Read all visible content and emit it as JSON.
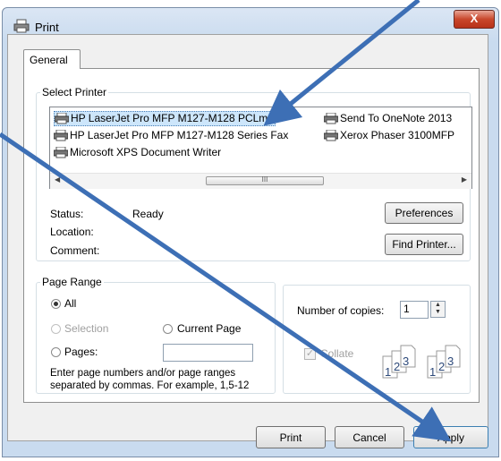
{
  "window": {
    "title": "Print",
    "close_label": "X"
  },
  "tabs": [
    {
      "label": "General"
    }
  ],
  "select_printer": {
    "legend": "Select Printer",
    "printers": [
      {
        "name": "HP LaserJet Pro MFP M127-M128 PCLmS",
        "selected": true
      },
      {
        "name": "Send To OneNote 2013",
        "selected": false
      },
      {
        "name": "HP LaserJet Pro MFP M127-M128 Series Fax",
        "selected": false
      },
      {
        "name": "Xerox Phaser 3100MFP",
        "selected": false
      },
      {
        "name": "Microsoft XPS Document Writer",
        "selected": false
      }
    ],
    "scroll_thumb_label": "III",
    "status_label": "Status:",
    "status_value": "Ready",
    "location_label": "Location:",
    "comment_label": "Comment:",
    "preferences_button": "Preferences",
    "find_printer_button": "Find Printer..."
  },
  "page_range": {
    "legend": "Page Range",
    "all_label": "All",
    "selection_label": "Selection",
    "current_page_label": "Current Page",
    "pages_label": "Pages:",
    "pages_value": "",
    "hint_line1": "Enter page numbers and/or page ranges",
    "hint_line2": "separated by commas.  For example, 1,5-12",
    "selected_option": "All"
  },
  "copies": {
    "number_label": "Number of copies:",
    "number_value": "1",
    "collate_label": "Collate",
    "collate_checked": true,
    "collate_icon_digits": [
      "1",
      "2",
      "3"
    ]
  },
  "buttons": {
    "print": "Print",
    "cancel": "Cancel",
    "apply": "Apply"
  },
  "colors": {
    "annotation_arrow": "#3d6fb5",
    "selection": "#cde6fb"
  }
}
